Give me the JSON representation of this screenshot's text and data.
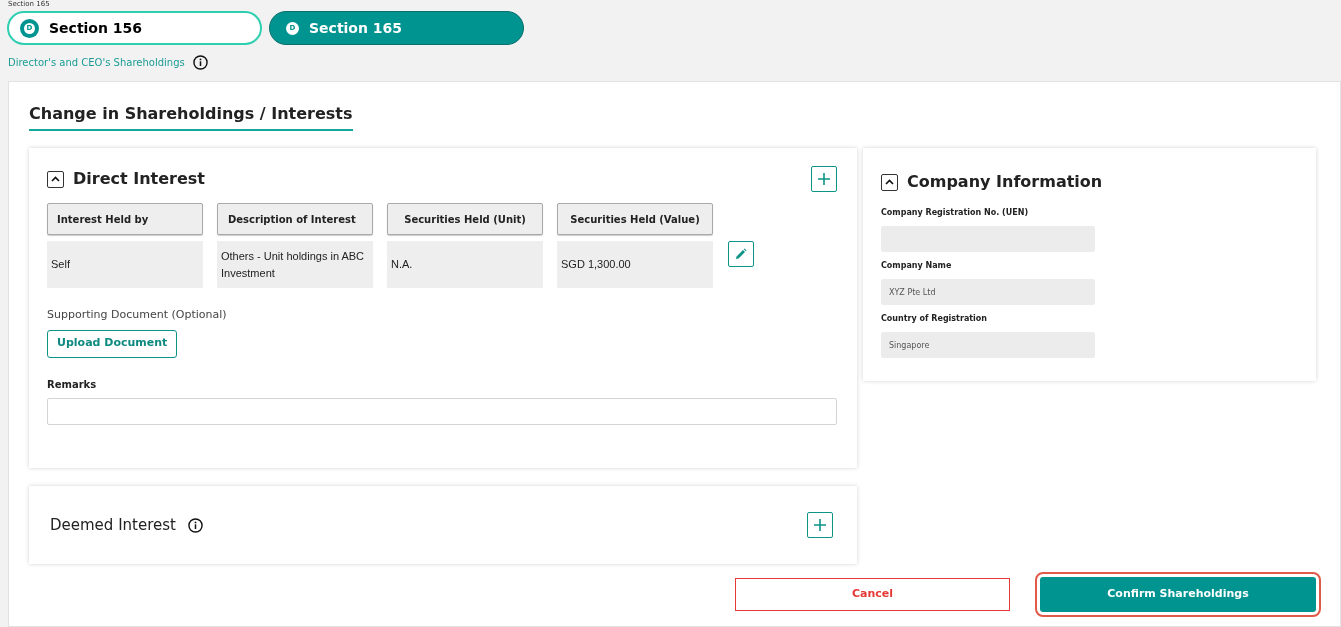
{
  "breadcrumb": "Section 165",
  "tabs": [
    {
      "badge": "D",
      "label": "Section 156",
      "selected": false
    },
    {
      "badge": "D",
      "label": "Section 165",
      "selected": true
    }
  ],
  "info_link": "Director's and CEO's Shareholdings",
  "page_title": "Change in Shareholdings / Interests",
  "direct_interest": {
    "title": "Direct Interest",
    "expanded": true,
    "columns": [
      "Interest Held by",
      "Description of Interest",
      "Securities Held (Unit)",
      "Securities Held (Value)"
    ],
    "rows": [
      [
        "Self",
        "Others - Unit holdings in ABC Investment",
        "N.A.",
        "SGD 1,300.00"
      ]
    ],
    "document_label": "Supporting Document (Optional)",
    "upload_button": "Upload Document",
    "remarks_label": "Remarks"
  },
  "deemed_interest": {
    "title": "Deemed Interest"
  },
  "company_info": {
    "title": "Company Information",
    "expanded": true,
    "fields": [
      {
        "label": "Company Registration No. (UEN)"
      },
      {
        "label": "Company Name",
        "value": "XYZ Pte Ltd"
      },
      {
        "label": "Country of Registration",
        "value": "Singapore"
      }
    ]
  },
  "buttons": {
    "cancel": "Cancel",
    "confirm": "Confirm Shareholdings"
  }
}
